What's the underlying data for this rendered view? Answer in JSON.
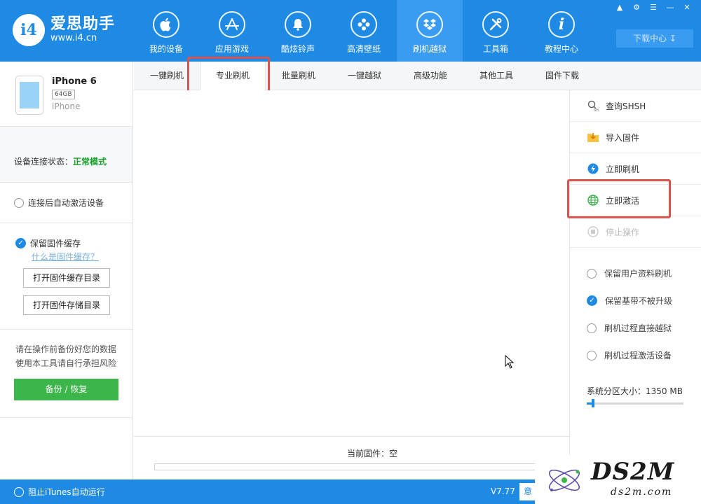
{
  "app": {
    "logo_badge": "i4",
    "logo_title": "爱思助手",
    "logo_url": "www.i4.cn"
  },
  "nav": {
    "items": [
      {
        "label": "我的设备",
        "icon": "apple-icon"
      },
      {
        "label": "应用游戏",
        "icon": "app-store-icon"
      },
      {
        "label": "酷炫铃声",
        "icon": "bell-icon"
      },
      {
        "label": "高清壁纸",
        "icon": "flower-icon"
      },
      {
        "label": "刷机越狱",
        "icon": "dropbox-icon"
      },
      {
        "label": "工具箱",
        "icon": "tools-icon"
      },
      {
        "label": "教程中心",
        "icon": "info-icon"
      }
    ],
    "active_index": 4,
    "download_center": "下载中心"
  },
  "device": {
    "name": "iPhone 6",
    "capacity": "64GB",
    "model": "iPhone"
  },
  "sidebar": {
    "status_label": "设备连接状态：",
    "status_value": "正常模式",
    "auto_activate": "连接后自动激活设备",
    "keep_cache": "保留固件缓存",
    "what_is_cache": "什么是固件缓存？",
    "open_cache_dir": "打开固件缓存目录",
    "open_storage_dir": "打开固件存储目录",
    "warning_line1": "请在操作前备份好您的数据",
    "warning_line2": "使用本工具请自行承担风险",
    "backup_button": "备份 / 恢复"
  },
  "subtabs": [
    "一键刷机",
    "专业刷机",
    "批量刷机",
    "一键越狱",
    "高级功能",
    "其他工具",
    "固件下载"
  ],
  "active_subtab": 1,
  "main": {
    "current_firmware": "当前固件：空"
  },
  "right_panel": {
    "actions": [
      {
        "label": "查询SHSH",
        "icon": "search-shsh-icon"
      },
      {
        "label": "导入固件",
        "icon": "import-folder-icon"
      },
      {
        "label": "立即刷机",
        "icon": "lightning-icon"
      },
      {
        "label": "立即激活",
        "icon": "globe-icon"
      },
      {
        "label": "停止操作",
        "icon": "stop-icon"
      }
    ],
    "options": [
      {
        "label": "保留用户资料刷机",
        "checked": false
      },
      {
        "label": "保留基带不被升级",
        "checked": true
      },
      {
        "label": "刷机过程直接越狱",
        "checked": false
      },
      {
        "label": "刷机过程激活设备",
        "checked": false
      }
    ],
    "system_partition": "系统分区大小：1350 MB",
    "slider_fraction": 0.05
  },
  "bottom": {
    "itunes": "阻止iTunes自动运行",
    "version": "V7.77",
    "feedback": "意"
  },
  "watermark": {
    "big": "DS2M",
    "small": "ds2m.com"
  },
  "colors": {
    "brand_blue": "#1e8ae3",
    "green": "#3cb64a",
    "highlight_red": "#d9534f"
  }
}
